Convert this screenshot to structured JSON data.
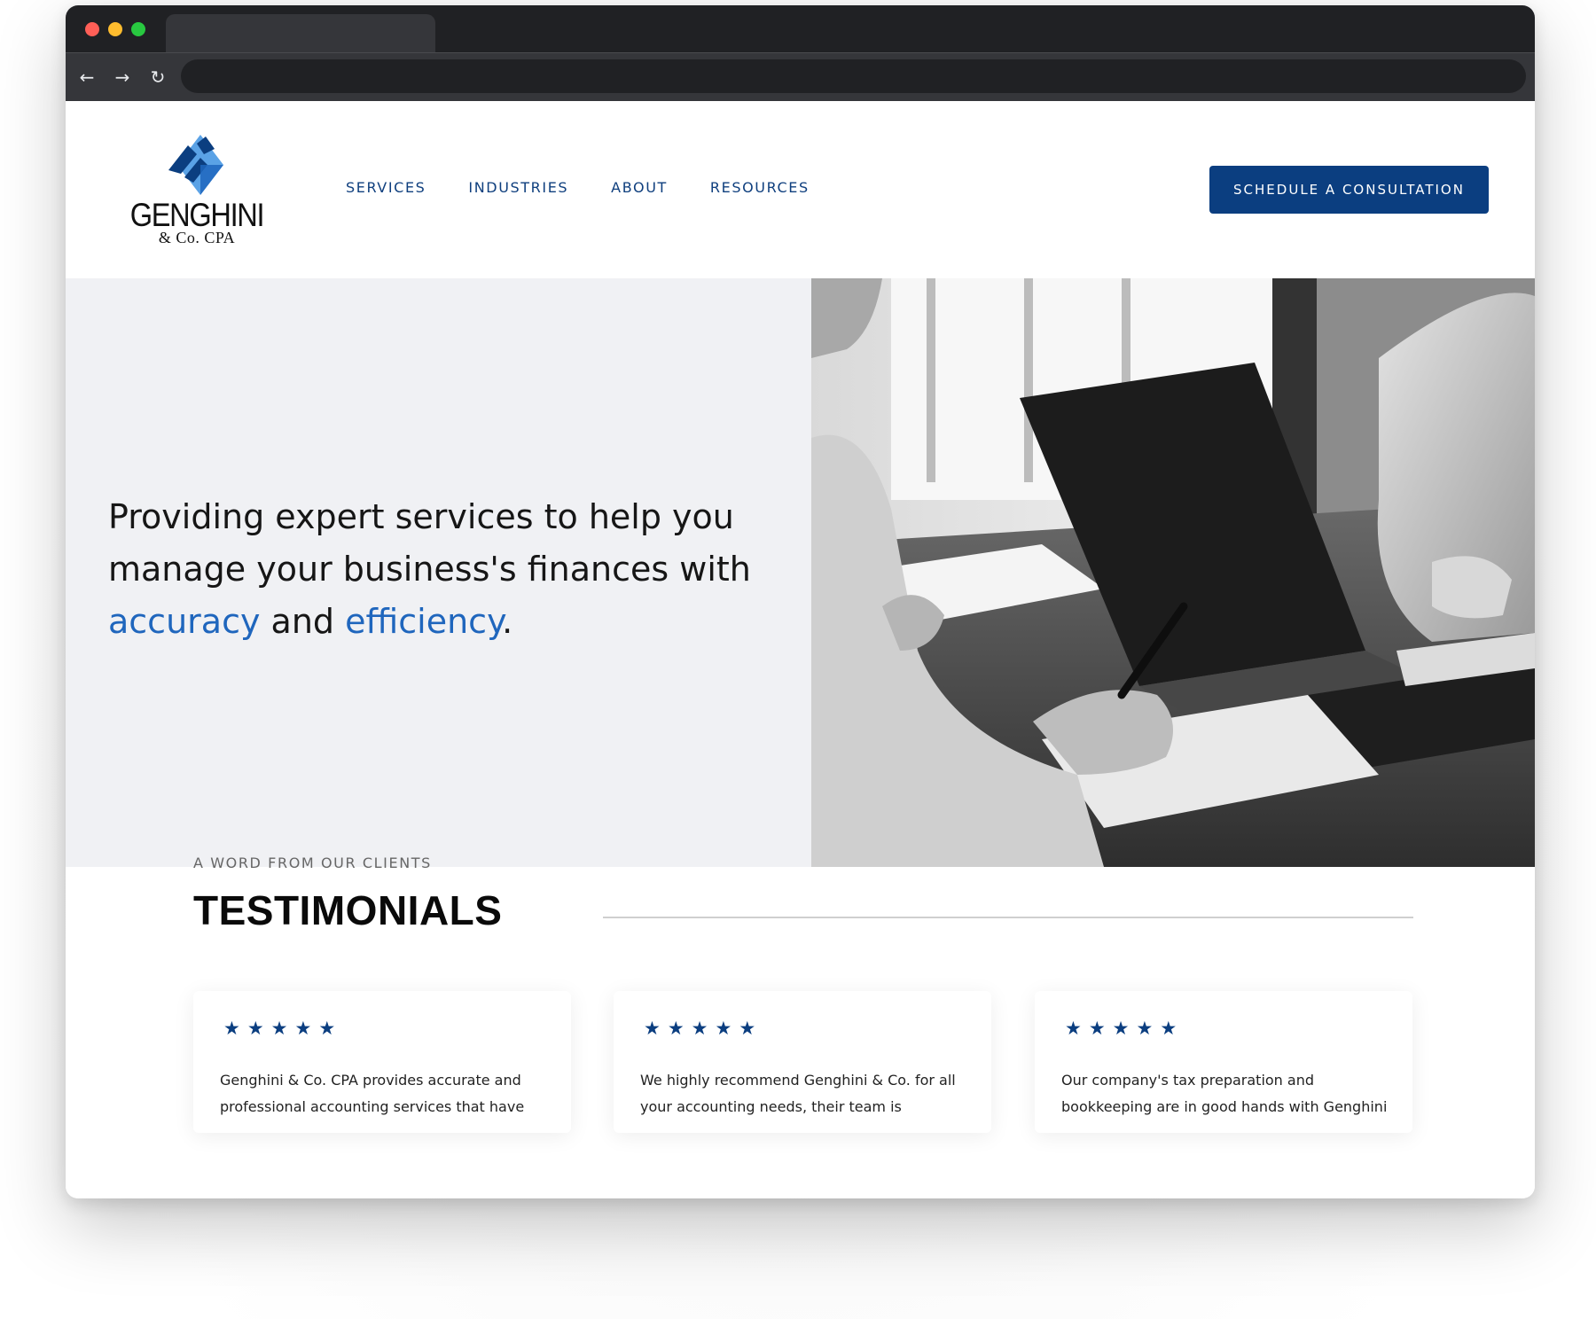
{
  "browser": {
    "nav_icons": [
      "back-arrow-icon",
      "forward-arrow-icon",
      "reload-icon"
    ],
    "back_glyph": "←",
    "forward_glyph": "→",
    "reload_glyph": "↻"
  },
  "brand": {
    "name": "GENGHINI",
    "subtitle": "& Co. CPA",
    "colors": {
      "primary": "#0b3e80",
      "accent": "#1f66bd",
      "logo_light": "#5aa2e6"
    }
  },
  "nav": {
    "items": [
      {
        "label": "SERVICES"
      },
      {
        "label": "INDUSTRIES"
      },
      {
        "label": "ABOUT"
      },
      {
        "label": "RESOURCES"
      }
    ],
    "cta_label": "SCHEDULE A CONSULTATION"
  },
  "hero": {
    "line_prefix": "Providing expert services to help you manage your business's finances with",
    "accent_1": "accuracy",
    "connector": "and",
    "accent_2": "efficiency",
    "end_punct": "."
  },
  "testimonials": {
    "eyebrow": "A WORD FROM OUR CLIENTS",
    "title": "TESTIMONIALS",
    "star_glyph": "★",
    "cards": [
      {
        "rating": 5,
        "text": "Genghini & Co. CPA provides accurate and professional accounting services that have"
      },
      {
        "rating": 5,
        "text": "We highly recommend Genghini & Co. for all your accounting needs, their team is"
      },
      {
        "rating": 5,
        "text": "Our company's tax preparation and bookkeeping are in good hands with Genghini"
      }
    ]
  }
}
